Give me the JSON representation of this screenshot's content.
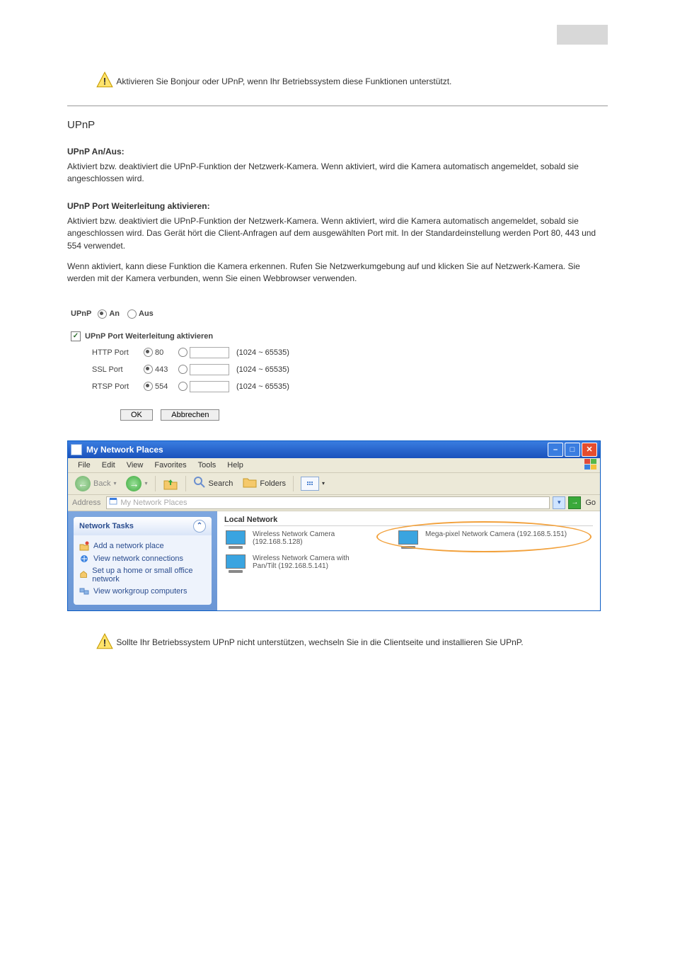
{
  "grayBox": true,
  "intro": "Aktivieren Sie Bonjour oder UPnP, wenn Ihr Betriebssystem diese Funktionen unterstützt.",
  "section": {
    "heading": "UPnP",
    "enable_sub": "UPnP An/Aus:",
    "enable_text": "Aktiviert bzw. deaktiviert die UPnP-Funktion der Netzwerk-Kamera. Wenn aktiviert, wird die Kamera automatisch angemeldet, sobald sie angeschlossen wird.",
    "port_sub": "UPnP Port Weiterleitung aktivieren:",
    "port_text": "Aktiviert bzw. deaktiviert die UPnP-Funktion der Netzwerk-Kamera. Wenn aktiviert, wird die Kamera automatisch angemeldet, sobald sie angeschlossen wird. Das Gerät hört die Client-Anfragen auf dem ausgewählten Port mit. In der Standardeinstellung werden Port 80, 443 und 554 verwendet.",
    "upnp_end_text": "Wenn aktiviert, kann diese Funktion die Kamera erkennen. Rufen Sie Netzwerkumgebung auf und klicken Sie auf Netzwerk-Kamera. Sie werden mit der Kamera verbunden, wenn Sie einen Webbrowser verwenden."
  },
  "upnp": {
    "title_label": "UPnP",
    "on_label": "An",
    "off_label": "Aus",
    "on_checked": true,
    "checkbox_label": "UPnP Port Weiterleitung aktivieren",
    "checkbox_checked": true,
    "ports": [
      {
        "label": "HTTP Port",
        "def": "80",
        "def_checked": true,
        "range": "(1024 ~ 65535)"
      },
      {
        "label": "SSL Port",
        "def": "443",
        "def_checked": true,
        "range": "(1024 ~ 65535)"
      },
      {
        "label": "RTSP Port",
        "def": "554",
        "def_checked": true,
        "range": "(1024 ~ 65535)"
      }
    ],
    "ok_label": "OK",
    "cancel_label": "Abbrechen"
  },
  "explorer": {
    "title": "My Network Places",
    "menu": [
      "File",
      "Edit",
      "View",
      "Favorites",
      "Tools",
      "Help"
    ],
    "toolbar": {
      "back": "Back",
      "search": "Search",
      "folders": "Folders"
    },
    "address_label": "Address",
    "address_value": "My Network Places",
    "go_label": "Go",
    "sidebar": {
      "panel_title": "Network Tasks",
      "items": [
        "Add a network place",
        "View network connections",
        "Set up a home or small office network",
        "View workgroup computers"
      ]
    },
    "content": {
      "header": "Local Network",
      "cams": [
        {
          "line1": "Wireless Network Camera",
          "line2": "(192.168.5.128)"
        },
        {
          "line1": "Mega-pixel Network Camera (192.168.5.151)",
          "line2": ""
        },
        {
          "line1": "Wireless Network Camera with",
          "line2": "Pan/Tilt (192.168.5.141)"
        }
      ]
    }
  },
  "bottom_note": "Sollte Ihr Betriebssystem UPnP nicht unterstützen, wechseln Sie in die Clientseite und installieren Sie UPnP."
}
